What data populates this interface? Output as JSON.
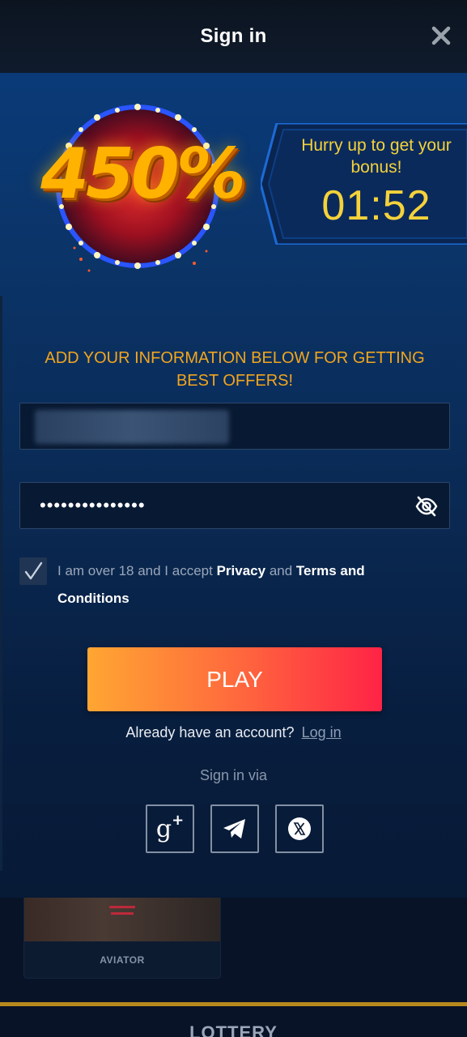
{
  "header": {
    "title": "Sign in",
    "close_icon": "close-icon"
  },
  "promo": {
    "percent": "450%",
    "timer_text": "Hurry up to get your bonus!",
    "timer_value": "01:52"
  },
  "form": {
    "heading": "ADD YOUR INFORMATION BELOW FOR GETTING BEST OFFERS!",
    "password_value": "•••••••••••••••",
    "consent": {
      "prefix": "I am over 18 and I accept",
      "privacy": "Privacy",
      "and": "and",
      "terms": "Terms and Conditions"
    },
    "play_label": "PLAY",
    "account_text": "Already have an account?",
    "login_label": "Log in",
    "signin_via": "Sign in via"
  },
  "background": {
    "aviator_label": "AVIATOR",
    "lottery_label": "LOTTERY"
  },
  "colors": {
    "accent_orange": "#f2a51d",
    "timer_yellow": "#f4d23a",
    "play_gradient_start": "#ffa632",
    "play_gradient_end": "#ff2346"
  }
}
